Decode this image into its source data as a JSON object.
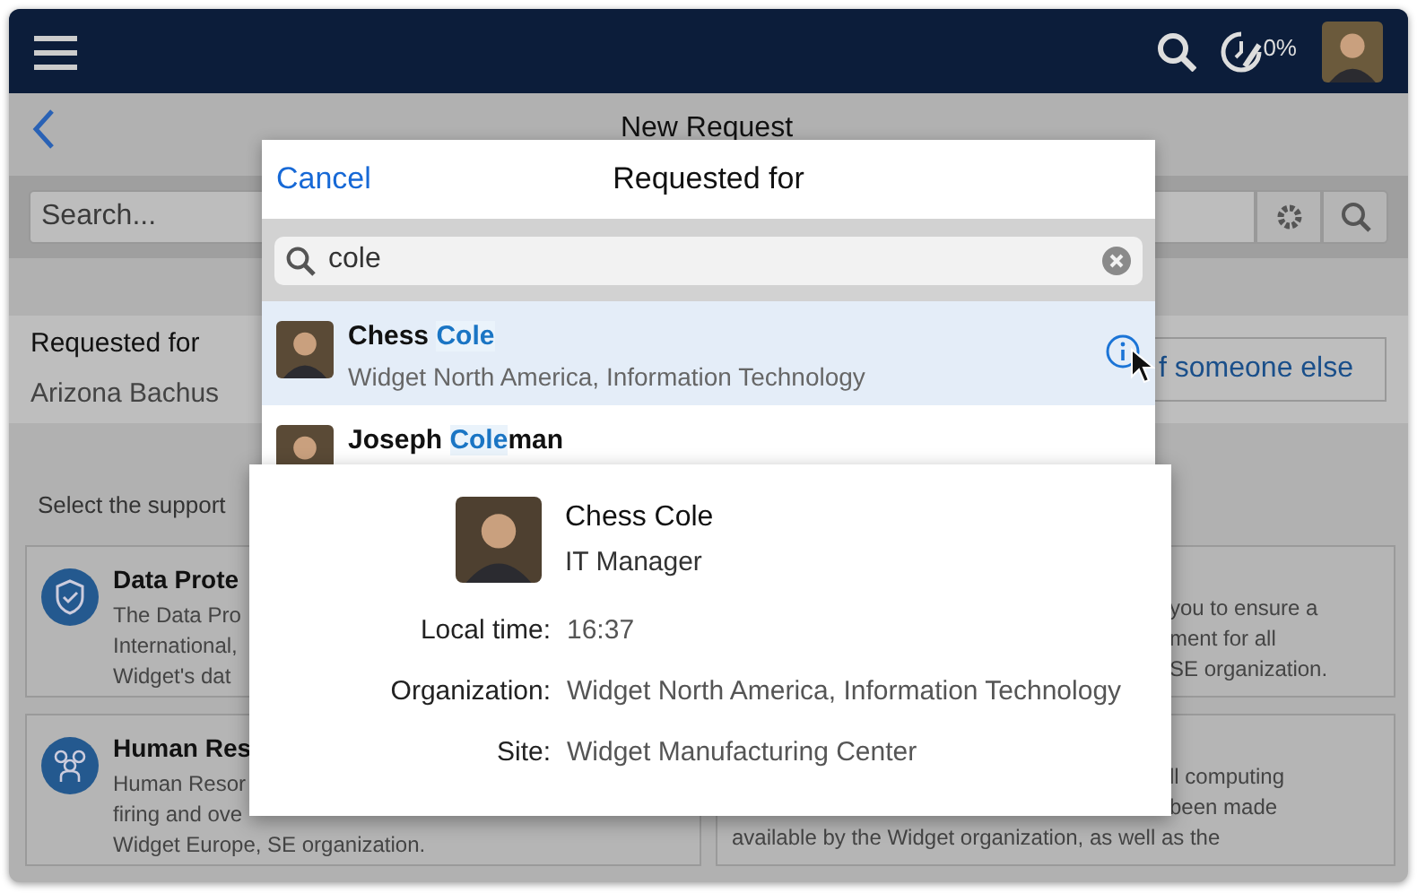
{
  "app_bar": {
    "progress": "0%"
  },
  "page": {
    "title": "New Request",
    "search_placeholder": "Search...",
    "requested_for_label": "Requested for",
    "requested_for_value": "Arizona Bachus",
    "other_button": "f someone else",
    "instruction": "Select the support",
    "cards": [
      {
        "kind": "shield",
        "title": "Data Prote",
        "lines": [
          {
            "text": "The Data Pro",
            "partly_hidden": false
          },
          {
            "text": "International,",
            "partly_hidden": false
          },
          {
            "text": "Widget's dat",
            "partly_hidden": false
          }
        ]
      },
      {
        "kind": "plain",
        "lines": [
          {
            "text": "you to ensure a",
            "partly_hidden": true
          },
          {
            "text": "ment for all",
            "partly_hidden": true
          },
          {
            "text": "SE organization.",
            "partly_hidden": true
          }
        ]
      },
      {
        "kind": "people",
        "title": "Human Res",
        "lines": [
          {
            "text": "Human Resor",
            "partly_hidden": false
          },
          {
            "text": "firing and ove",
            "partly_hidden": false
          },
          {
            "text": "Widget Europe, SE organization.",
            "partly_hidden": false
          }
        ]
      },
      {
        "kind": "plain",
        "lines": [
          {
            "text": "ll computing",
            "partly_hidden": true
          },
          {
            "text": "been made",
            "partly_hidden": true
          },
          {
            "text": "available by the Widget organization, as well as the",
            "partly_hidden": false
          }
        ]
      }
    ]
  },
  "dialog": {
    "cancel": "Cancel",
    "title": "Requested for",
    "search": {
      "value": "cole"
    },
    "results": [
      {
        "name_parts": [
          {
            "text": "Chess ",
            "match": false
          },
          {
            "text": "Cole",
            "match": true
          }
        ],
        "subtitle": "Widget North America, Information Technology",
        "selected": true
      },
      {
        "name_parts": [
          {
            "text": "Joseph ",
            "match": false
          },
          {
            "text": "Cole",
            "match": true
          },
          {
            "text": "man",
            "match": false
          }
        ],
        "selected": false
      }
    ]
  },
  "popover": {
    "name": "Chess Cole",
    "job_title": "IT Manager",
    "fields": [
      {
        "label": "Local time:",
        "value": "16:37"
      },
      {
        "label": "Organization:",
        "value": "Widget North America, Information Technology"
      },
      {
        "label": "Site:",
        "value": "Widget Manufacturing Center"
      }
    ]
  }
}
